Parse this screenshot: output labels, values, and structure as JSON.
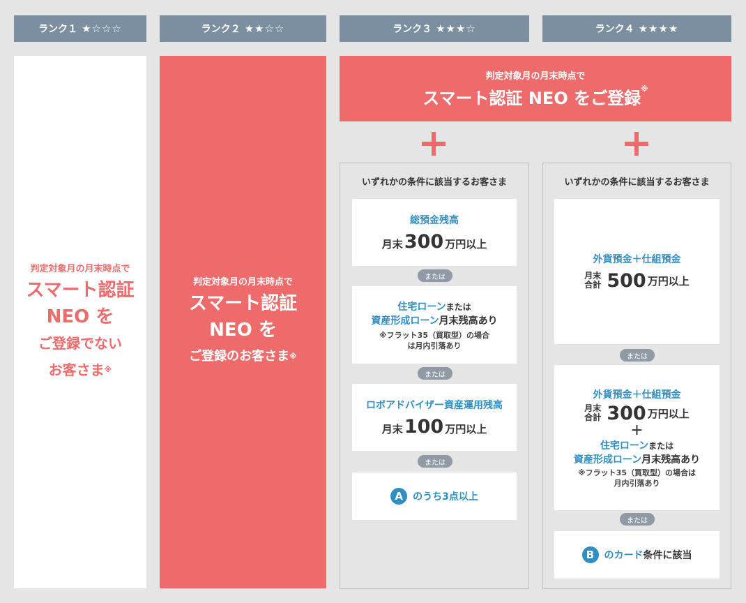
{
  "headers": [
    {
      "label": "ランク１",
      "stars": "★☆☆☆"
    },
    {
      "label": "ランク２",
      "stars": "★★☆☆"
    },
    {
      "label": "ランク３",
      "stars": "★★★☆"
    },
    {
      "label": "ランク４",
      "stars": "★★★★"
    }
  ],
  "rank1": {
    "lead": "判定対象月の月末時点で",
    "line1": "スマート認証",
    "line2": "NEO を",
    "line3": "ご登録でない",
    "line4": "お客さま",
    "mark": "※"
  },
  "rank2": {
    "lead": "判定対象月の月末時点で",
    "line1": "スマート認証",
    "line2": "NEO を",
    "line3": "ご登録のお客さま",
    "mark": "※"
  },
  "top_banner": {
    "lead": "判定対象月の月末時点で",
    "main": "スマート認証 NEO をご登録",
    "mark": "※"
  },
  "rank3": {
    "title": "いずれかの条件に該当するお客さま",
    "or": "または",
    "card1": {
      "title": "総預金残高",
      "prefix": "月末",
      "amount": "300",
      "suffix": "万円以上"
    },
    "card2": {
      "title_a": "住宅ローン",
      "title_b": "または",
      "title_c": "資産形成ローン",
      "title_d": "月末残高あり",
      "note1": "※フラット35（買取型）の場合",
      "note2": "は月内引落あり"
    },
    "card3": {
      "title": "ロボアドバイザー資産運用残高",
      "prefix": "月末",
      "amount": "100",
      "suffix": "万円以上"
    },
    "card4": {
      "badge": "A",
      "text": "のうち3点以上"
    }
  },
  "rank4": {
    "title": "いずれかの条件に該当するお客さま",
    "or": "または",
    "card1": {
      "title": "外貨預金＋仕組預金",
      "stack_a": "月末",
      "stack_b": "合計",
      "amount": "500",
      "suffix": "万円以上"
    },
    "card2": {
      "title": "外貨預金＋仕組預金",
      "stack_a": "月末",
      "stack_b": "合計",
      "amount": "300",
      "suffix": "万円以上",
      "plus": "＋",
      "loan_a": "住宅ローン",
      "loan_b": "または",
      "loan_c": "資産形成ローン",
      "loan_d": "月末残高あり",
      "note1": "※フラット35（買取型）の場合は",
      "note2": "月内引落あり"
    },
    "card3": {
      "badge": "B",
      "text_a": "のカード",
      "text_b": "条件に該当"
    }
  },
  "colors": {
    "red": "#ef6b6b",
    "header": "#7c8fa1",
    "blue": "#2f8fc4",
    "pill": "#8f9aa5"
  }
}
